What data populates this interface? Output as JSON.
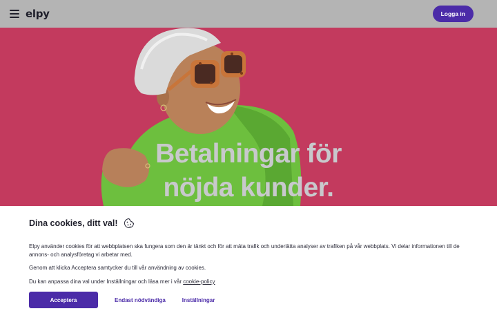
{
  "header": {
    "logo": "elpy",
    "login_label": "Logga in"
  },
  "hero": {
    "title_line1": "Betalningar för",
    "title_line2": "nöjda kunder."
  },
  "cookie": {
    "title": "Dina cookies, ditt val!",
    "paragraph1": "Elpy använder cookies för att webbplatsen ska fungera som den är tänkt och för att mäta trafik och underlätta analyser av trafiken på vår webbplats. Vi delar informationen till de annons- och analysföretag vi arbetar med.",
    "paragraph2": "Genom att klicka Acceptera samtycker du till vår användning av cookies.",
    "paragraph3_prefix": "Du kan anpassa dina val under Inställningar och läsa mer i vår ",
    "policy_link": "cookie-policy",
    "accept_label": "Acceptera",
    "necessary_label": "Endast nödvändiga",
    "settings_label": "Inställningar"
  },
  "colors": {
    "brand": "#4b2ba8",
    "hero_background": "#c33a5e",
    "header_background": "#b4b4b4"
  },
  "icons": [
    "menu-icon",
    "cookie-icon"
  ]
}
